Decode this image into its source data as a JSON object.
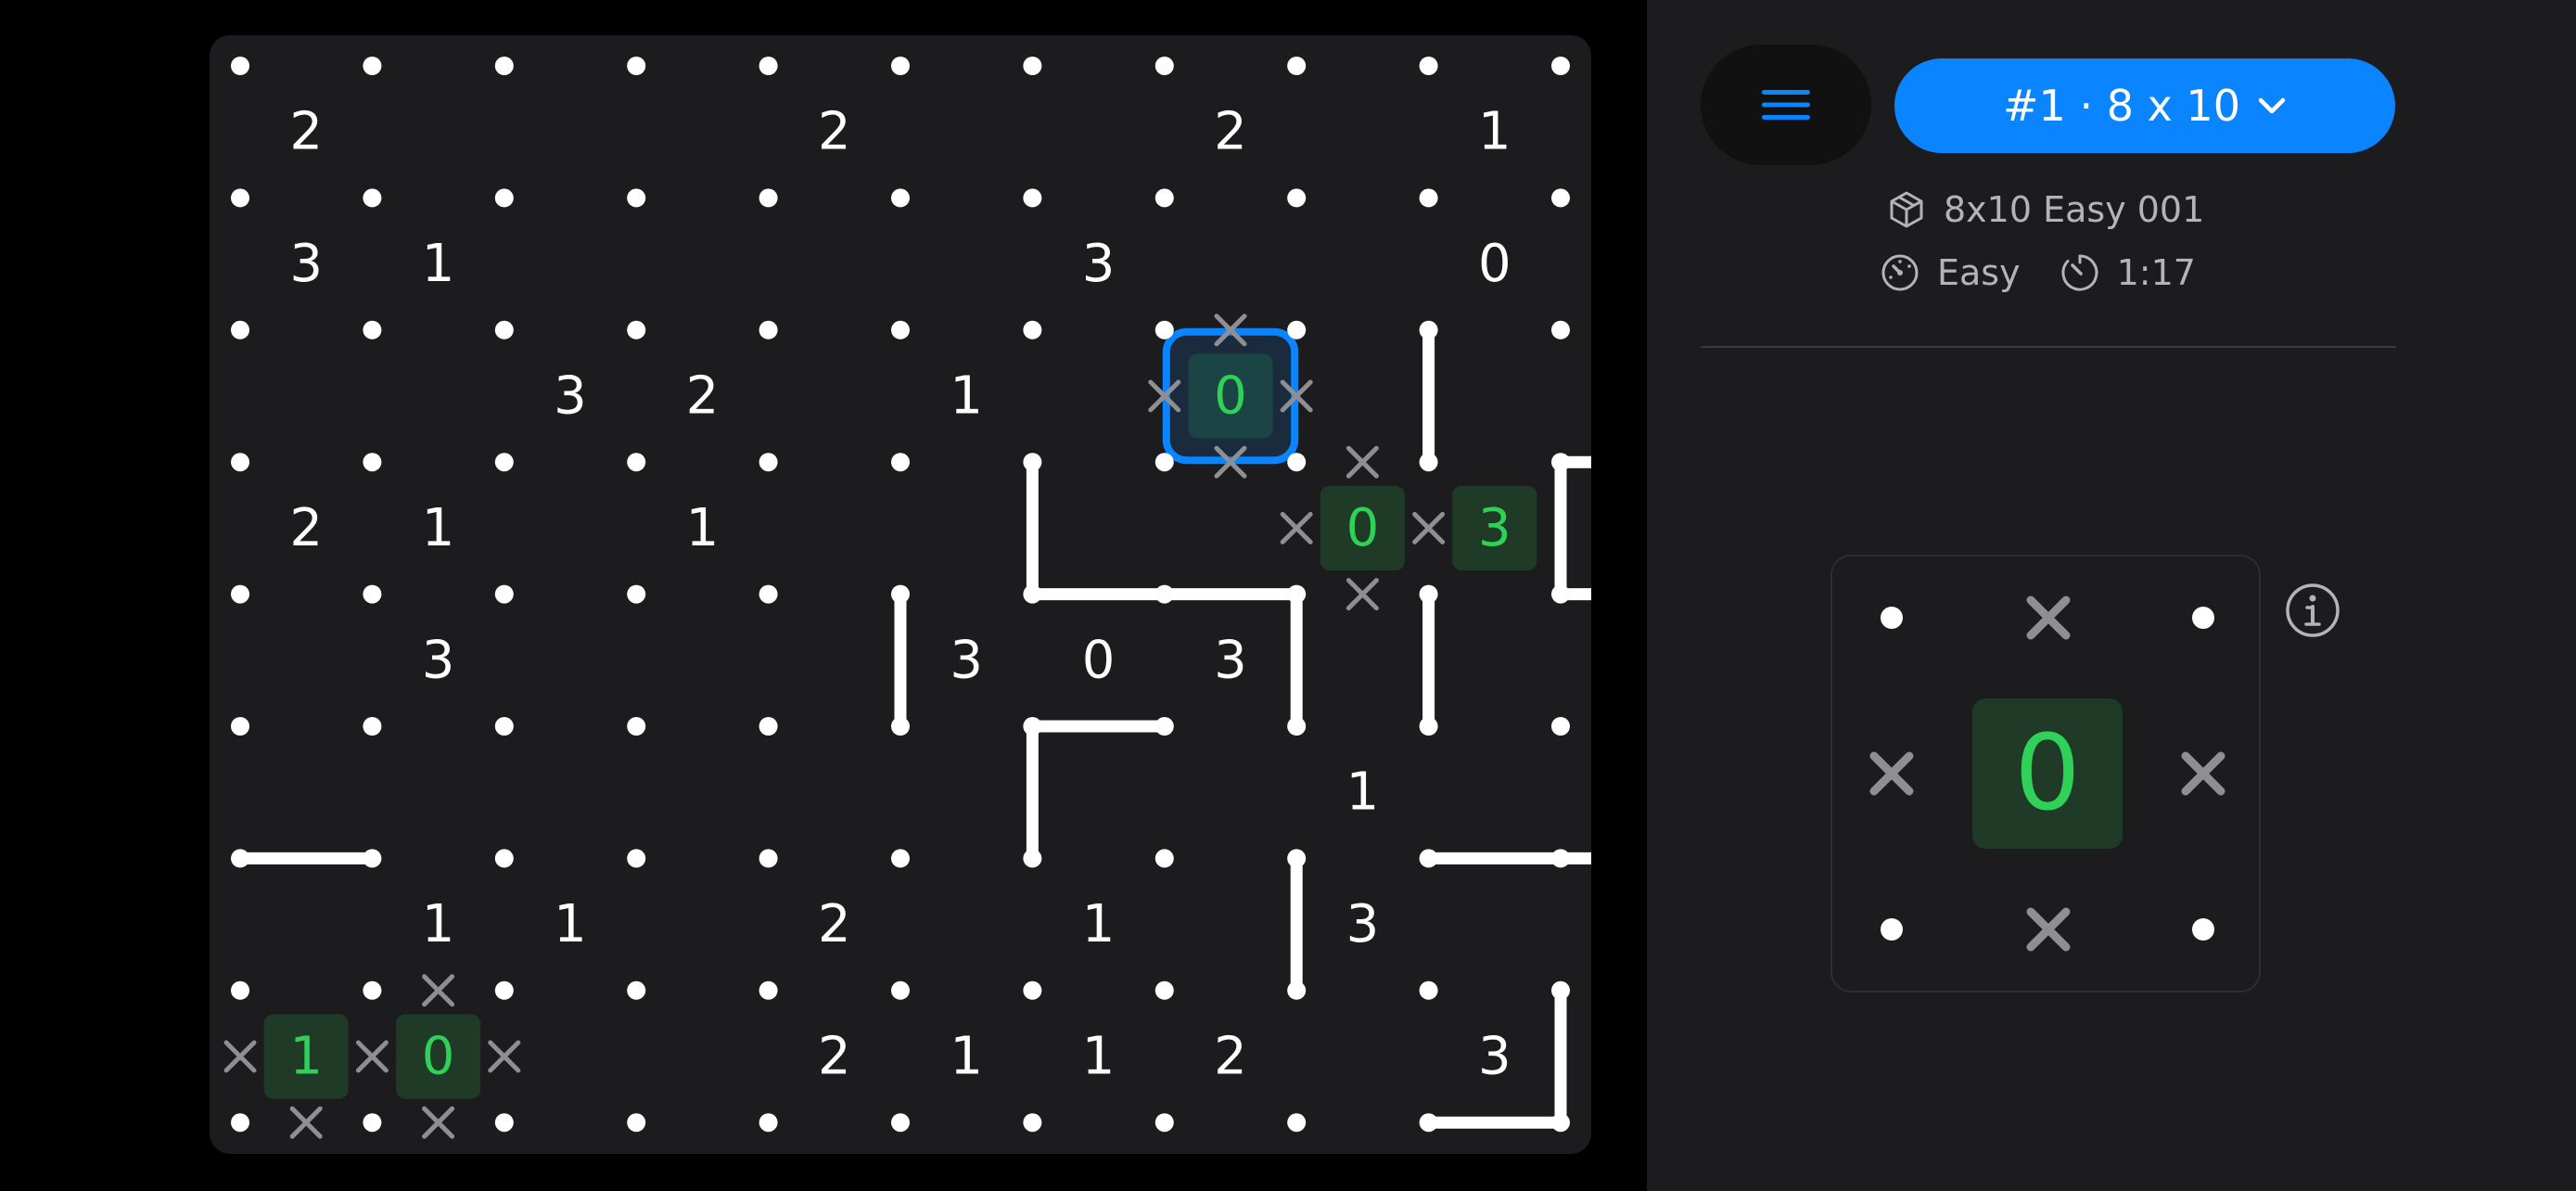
{
  "board": {
    "rows": 8,
    "cols": 10,
    "clues": [
      [
        2,
        null,
        null,
        null,
        2,
        null,
        null,
        2,
        null,
        1
      ],
      [
        3,
        1,
        null,
        null,
        null,
        null,
        3,
        null,
        null,
        0
      ],
      [
        null,
        null,
        3,
        2,
        null,
        1,
        null,
        0,
        null,
        null
      ],
      [
        2,
        1,
        null,
        1,
        null,
        null,
        null,
        null,
        0,
        3
      ],
      [
        null,
        3,
        null,
        null,
        null,
        3,
        0,
        3,
        null,
        null
      ],
      [
        null,
        null,
        null,
        null,
        null,
        null,
        null,
        null,
        1,
        null
      ],
      [
        null,
        1,
        1,
        null,
        2,
        null,
        1,
        null,
        3,
        null
      ],
      [
        1,
        0,
        null,
        null,
        2,
        1,
        1,
        2,
        null,
        3
      ]
    ],
    "satisfied_cells": [
      [
        2,
        7
      ],
      [
        3,
        8
      ],
      [
        3,
        9
      ],
      [
        7,
        0
      ],
      [
        7,
        1
      ]
    ],
    "selected_cell": [
      2,
      7
    ],
    "lines": [
      [
        "h",
        4,
        6
      ],
      [
        "h",
        4,
        7
      ],
      [
        "h",
        5,
        6
      ],
      [
        "h",
        6,
        0
      ],
      [
        "h",
        8,
        9
      ],
      [
        "h",
        6,
        9
      ],
      [
        "h",
        6,
        10
      ],
      [
        "h",
        3,
        10
      ],
      [
        "h",
        4,
        10
      ],
      [
        "v",
        3,
        6
      ],
      [
        "v",
        4,
        5
      ],
      [
        "v",
        5,
        6
      ],
      [
        "v",
        4,
        8
      ],
      [
        "v",
        2,
        9
      ],
      [
        "v",
        4,
        9
      ],
      [
        "v",
        6,
        8
      ],
      [
        "v",
        3,
        10
      ],
      [
        "v",
        7,
        10
      ]
    ],
    "crosses": [
      [
        "h",
        2,
        7
      ],
      [
        "h",
        3,
        7
      ],
      [
        "h",
        3,
        8
      ],
      [
        "h",
        4,
        8
      ],
      [
        "h",
        7,
        1
      ],
      [
        "h",
        8,
        0
      ],
      [
        "h",
        8,
        1
      ],
      [
        "v",
        2,
        7
      ],
      [
        "v",
        2,
        8
      ],
      [
        "v",
        3,
        8
      ],
      [
        "v",
        3,
        9
      ],
      [
        "v",
        7,
        0
      ],
      [
        "v",
        7,
        1
      ],
      [
        "v",
        7,
        2
      ]
    ],
    "colors": {
      "board_bg": "#1c1c1e",
      "dot": "#ffffff",
      "line": "#ffffff",
      "cross": "#8e8e93",
      "satisfied_text": "#30d158",
      "satisfied_bg": "#1f3a27",
      "selection": "#0a84ff",
      "clue_text": "#ffffff"
    }
  },
  "header": {
    "menu_icon": "hamburger-icon",
    "puzzle_label": "#1 · 8 x 10",
    "chevron_icon": "chevron-down-icon"
  },
  "info": {
    "puzzle_name": "8x10 Easy 001",
    "puzzle_icon": "cube-icon",
    "difficulty": "Easy",
    "difficulty_icon": "gauge-icon",
    "time": "1:17",
    "timer_icon": "timer-icon"
  },
  "help": {
    "value": "0",
    "info_icon": "info-icon"
  }
}
